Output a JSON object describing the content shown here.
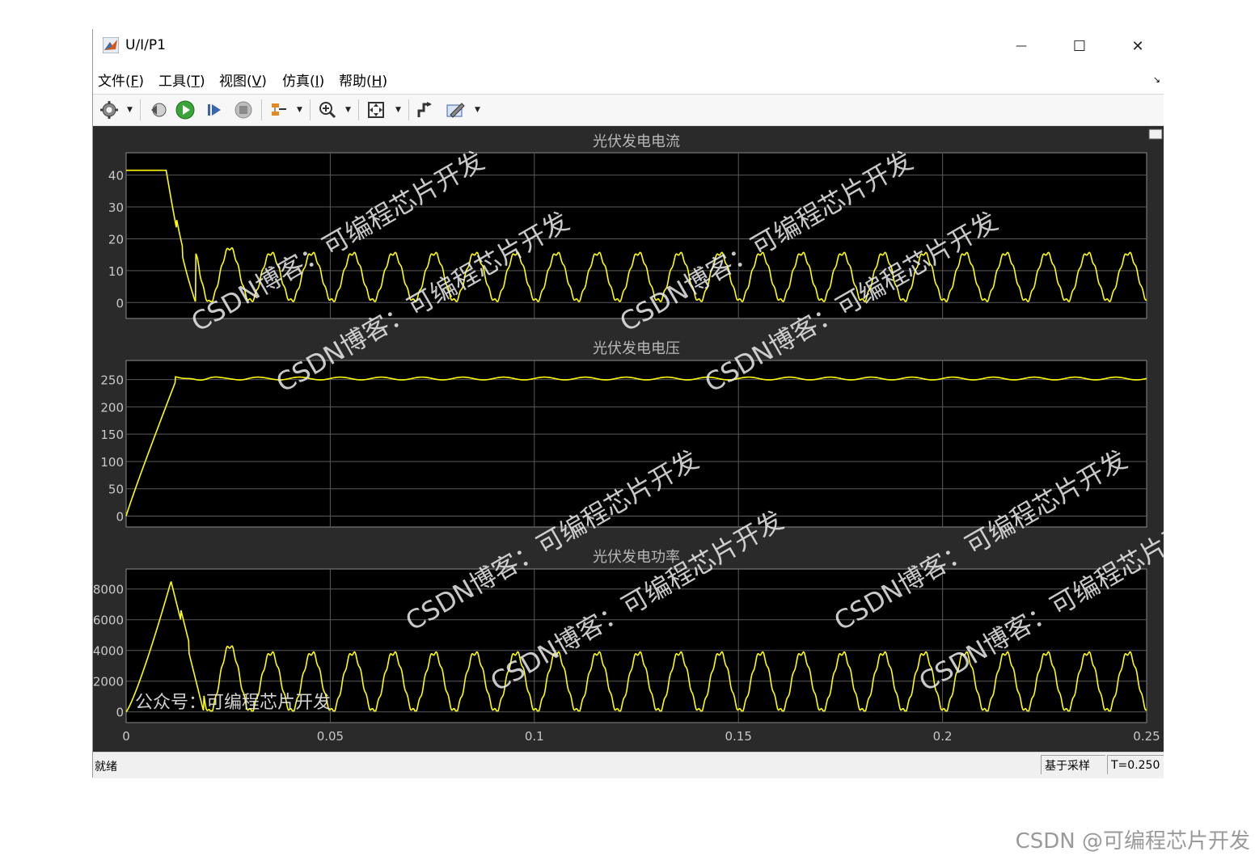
{
  "window": {
    "title": "U/I/P1",
    "controls": {
      "minimize": "—",
      "maximize": "☐",
      "close": "✕"
    }
  },
  "menu": {
    "items": [
      {
        "label": "文件(",
        "key": "F",
        "tail": ")"
      },
      {
        "label": "工具(",
        "key": "T",
        "tail": ")"
      },
      {
        "label": "视图(",
        "key": "V",
        "tail": ")"
      },
      {
        "label": "仿真(",
        "key": "I",
        "tail": ")"
      },
      {
        "label": "帮助(",
        "key": "H",
        "tail": ")"
      }
    ],
    "corner_arrow": "↘"
  },
  "toolbar": {
    "icons": [
      "gear-icon",
      "step-back-icon",
      "run-icon",
      "step-forward-icon",
      "stop-icon",
      "signal-selector-icon",
      "zoom-in-icon",
      "fit-view-icon",
      "cursor-measure-icon",
      "style-icon"
    ]
  },
  "chart_data": [
    {
      "type": "line",
      "title": "光伏发电电流",
      "xlim": [
        0,
        0.25
      ],
      "ylim": [
        -5,
        47
      ],
      "yticks": [
        "40",
        "30",
        "20",
        "10",
        "0"
      ],
      "ytick_values": [
        40,
        30,
        20,
        10,
        0
      ],
      "grid": true,
      "series": [
        {
          "color": "#ffff00",
          "model": "current",
          "start": 41.5,
          "drop_end": 0.017,
          "osc_amp": 7.5,
          "osc_mean": 8,
          "freq": 100
        }
      ]
    },
    {
      "type": "line",
      "title": "光伏发电电压",
      "xlim": [
        0,
        0.25
      ],
      "ylim": [
        -20,
        285
      ],
      "yticks": [
        "250",
        "200",
        "150",
        "100",
        "50",
        "0"
      ],
      "ytick_values": [
        250,
        200,
        150,
        100,
        50,
        0
      ],
      "grid": true,
      "series": [
        {
          "color": "#ffff00",
          "model": "voltage",
          "rise_end": 0.012,
          "plateau": 252,
          "ripple": 2.5,
          "freq": 100
        }
      ]
    },
    {
      "type": "line",
      "title": "光伏发电功率",
      "xlim": [
        0,
        0.25
      ],
      "ylim": [
        -700,
        9300
      ],
      "yticks": [
        "8000",
        "6000",
        "4000",
        "2000",
        "0"
      ],
      "ytick_values": [
        8000,
        6000,
        4000,
        2000,
        0
      ],
      "grid": true,
      "series": [
        {
          "color": "#ffff00",
          "model": "power",
          "peak": 8500,
          "peak_t": 0.011,
          "osc_amp": 1900,
          "osc_mean": 1950,
          "freq": 100
        }
      ]
    }
  ],
  "xticks": [
    "0",
    "0.05",
    "0.1",
    "0.15",
    "0.2",
    "0.25"
  ],
  "xtick_values": [
    0,
    0.05,
    0.1,
    0.15,
    0.2,
    0.25
  ],
  "watermarks": {
    "csdn_blog": "CSDN博客：可编程芯片开发",
    "gzh": "公众号：可编程芯片开发",
    "footer": "CSDN @可编程芯片开发"
  },
  "status": {
    "left": "就绪",
    "mode": "基于采样",
    "time": "T=0.250"
  }
}
